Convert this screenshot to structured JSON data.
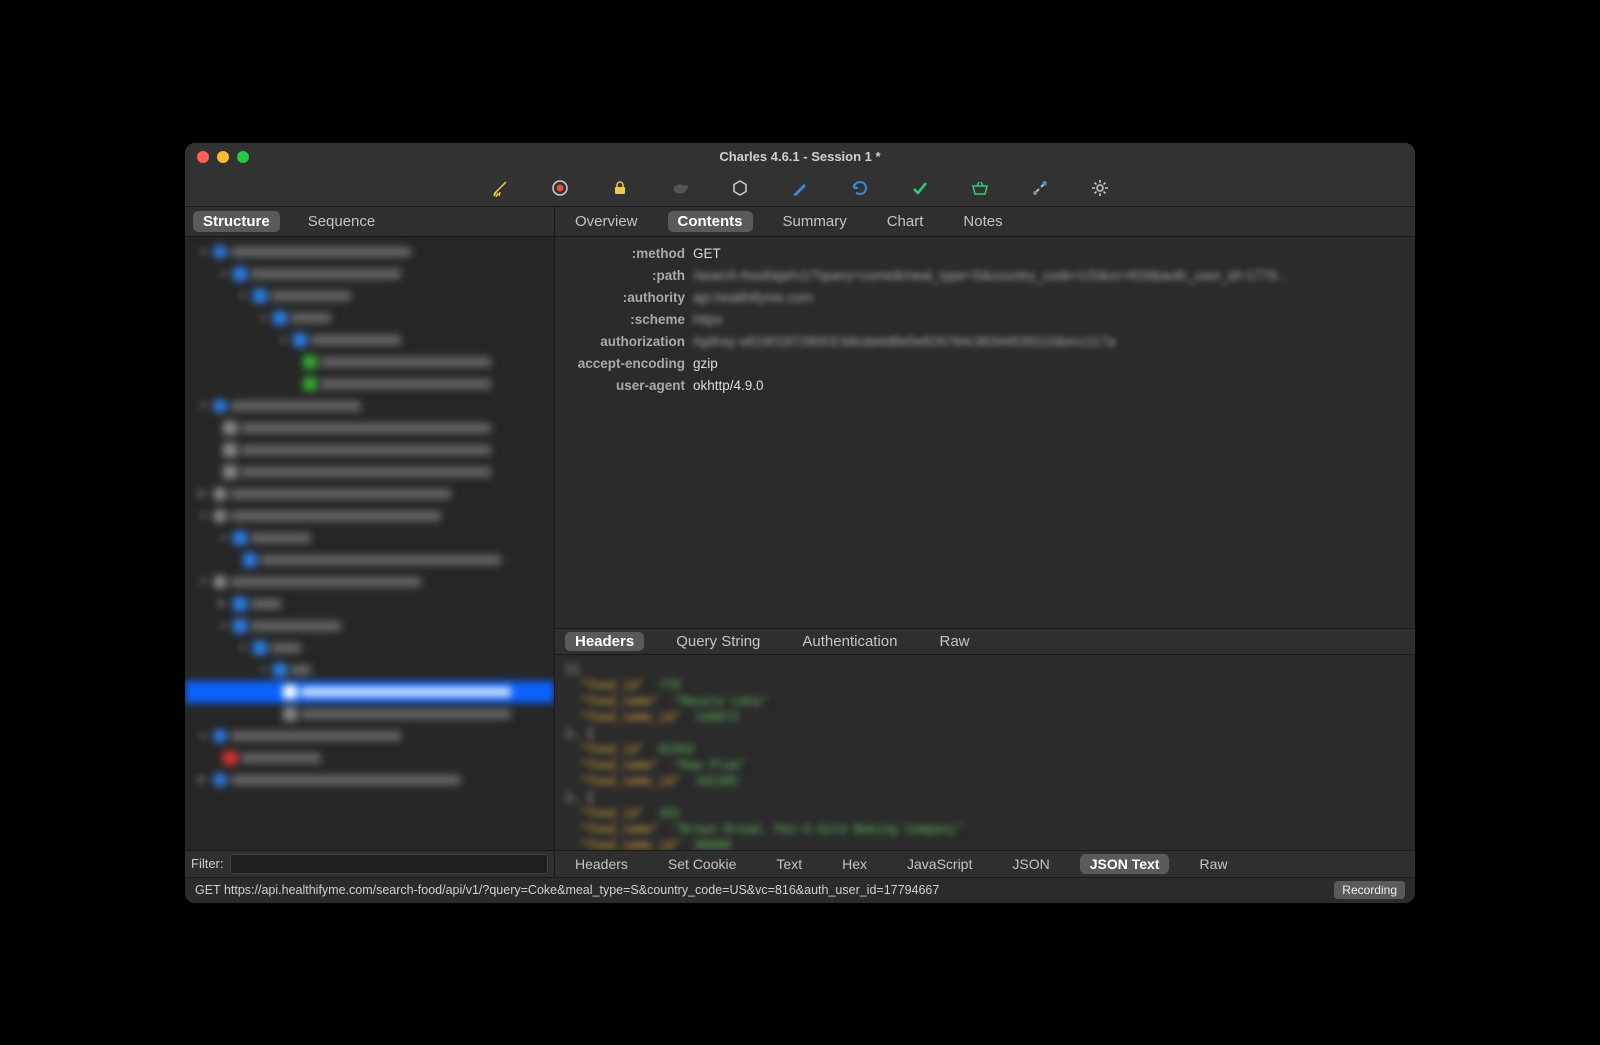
{
  "window": {
    "title": "Charles 4.6.1 - Session 1 *"
  },
  "sidebar": {
    "tabs": [
      "Structure",
      "Sequence"
    ],
    "active": 0,
    "filter": {
      "label": "Filter:",
      "value": ""
    }
  },
  "contentTabs": {
    "items": [
      "Overview",
      "Contents",
      "Summary",
      "Chart",
      "Notes"
    ],
    "active": 1
  },
  "headers": [
    {
      "key": ":method",
      "val": "GET",
      "clear": true
    },
    {
      "key": ":path",
      "val": "/search-food/api/v1/?query=come&meal_type=S&country_code=US&vc=816&auth_user_id=1779...",
      "clear": false
    },
    {
      "key": ":authority",
      "val": "api.healthifyme.com",
      "clear": false
    },
    {
      "key": ":scheme",
      "val": "https",
      "clear": false
    },
    {
      "key": "authorization",
      "val": "ApiKey e819018728003:b8cda4d8a5e829794c38344539110&ecc117a",
      "clear": false
    },
    {
      "key": "accept-encoding",
      "val": "gzip",
      "clear": true
    },
    {
      "key": "user-agent",
      "val": "okhttp/4.9.0",
      "clear": true
    }
  ],
  "midTabs": {
    "items": [
      "Headers",
      "Query String",
      "Authentication",
      "Raw"
    ],
    "active": 0
  },
  "bottomTabs": {
    "items": [
      "Headers",
      "Set Cookie",
      "Text",
      "Hex",
      "JavaScript",
      "JSON",
      "JSON Text",
      "Raw"
    ],
    "active": 6
  },
  "status": {
    "text": "GET https://api.healthifyme.com/search-food/api/v1/?query=Coke&meal_type=S&country_code=US&vc=816&auth_user_id=17794667",
    "badge": "Recording"
  }
}
